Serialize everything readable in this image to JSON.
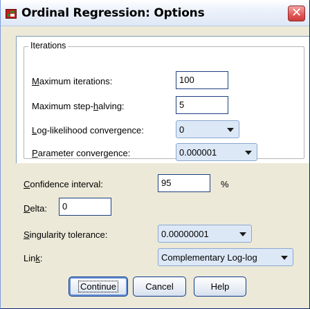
{
  "window": {
    "title": "Ordinal Regression: Options",
    "icon": "spss-table-icon",
    "close_glyph": "✕"
  },
  "iterations": {
    "legend": "Iterations",
    "max_iterations": {
      "label_underline": "M",
      "label_rest": "aximum iterations:",
      "value": "100"
    },
    "max_step_halving": {
      "label_pre": "Maximum step-",
      "label_underline": "h",
      "label_rest": "alving:",
      "value": "5"
    },
    "loglik_convergence": {
      "label_underline": "L",
      "label_rest": "og-likelihood convergence:",
      "value": "0"
    },
    "param_convergence": {
      "label_underline": "P",
      "label_rest": "arameter convergence:",
      "value": "0.000001"
    }
  },
  "confidence": {
    "label_underline": "C",
    "label_rest": "onfidence interval:",
    "value": "95",
    "unit": "%"
  },
  "delta": {
    "label_underline": "D",
    "label_rest": "elta:",
    "value": "0"
  },
  "singularity": {
    "label_underline": "S",
    "label_rest": "ingularity tolerance:",
    "value": "0.00000001"
  },
  "link": {
    "label_pre": "Lin",
    "label_underline": "k",
    "label_rest": ":",
    "value": "Complementary Log-log"
  },
  "buttons": {
    "continue": "Continue",
    "cancel": "Cancel",
    "help": "Help"
  }
}
